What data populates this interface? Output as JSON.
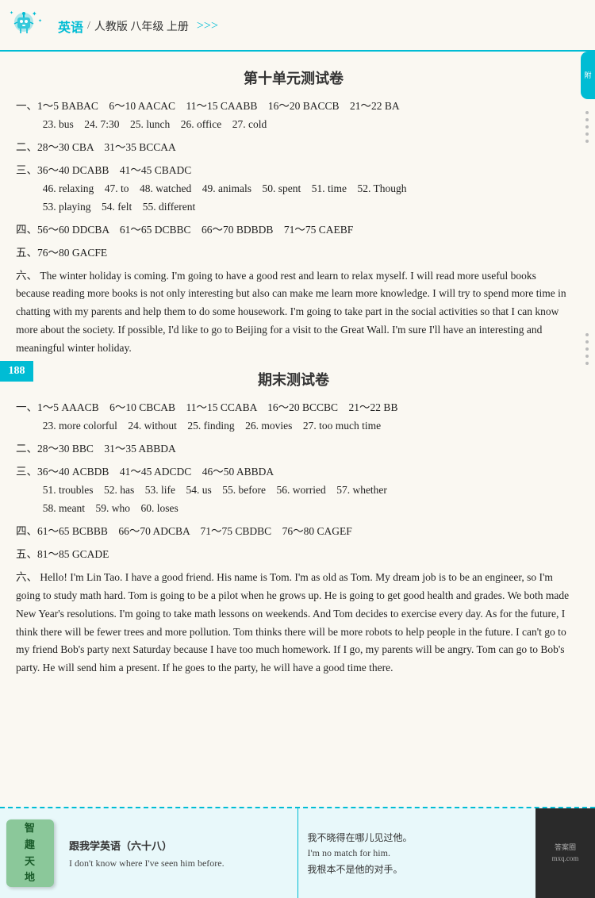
{
  "header": {
    "subject": "英语",
    "divider": "/",
    "grade_info": "人教版 八年级 上册",
    "arrows": ">>>",
    "logo_alt": "mascot-robot-logo"
  },
  "sections": [
    {
      "id": "section1",
      "title": "第十单元测试卷",
      "answers": [
        {
          "label": "一、",
          "lines": [
            "1～5 BABAC　6～10 AACAC　11～15 CAABB　16～20 BACCB　21～22 BA",
            "23. bus　24. 7:30　25. lunch　26. office　27. cold"
          ]
        },
        {
          "label": "二、",
          "lines": [
            "28～30 CBA　31～35 BCCAA"
          ]
        },
        {
          "label": "三、",
          "lines": [
            "36～40 DCABB　41～45 CBADC",
            "46. relaxing　47. to　48. watched　49. animals　50. spent　51. time　52. Though",
            "53. playing　54. felt　55. different"
          ]
        },
        {
          "label": "四、",
          "lines": [
            "56～60 DDCBA　61～65 DCBBC　66～70 BDBDB　71～75 CAEBF"
          ]
        },
        {
          "label": "五、",
          "lines": [
            "76～80 GACFE"
          ]
        },
        {
          "label": "六、",
          "is_essay": true,
          "text": "The winter holiday is coming. I'm going to have a good rest and learn to relax myself. I will read more useful books because reading more books is not only interesting but also can make me learn more knowledge. I will try to spend more time in chatting with my parents and help them to do some housework. I'm going to take part in the social activities so that I can know more about the society. If possible, I'd like to go to Beijing for a visit to the Great Wall. I'm sure I'll have an interesting and meaningful winter holiday."
        }
      ]
    },
    {
      "id": "section2",
      "title": "期末测试卷",
      "answers": [
        {
          "label": "一、",
          "lines": [
            "1～5 AAACB　6～10 CBCAB　11～15 CCABA　16～20 BCCBC　21～22 BB",
            "23. more colorful　24. without　25. finding　26. movies　27. too much time"
          ]
        },
        {
          "label": "二、",
          "lines": [
            "28～30 BBC　31～35 ABBDA"
          ]
        },
        {
          "label": "三、",
          "lines": [
            "36～40 ACBDB　41～45 ADCDC　46～50 ABBDA",
            "51. troubles　52. has　53. life　54. us　55. before　56. worried　57. whether",
            "58. meant　59. who　60. loses"
          ]
        },
        {
          "label": "四、",
          "lines": [
            "61～65 BCBBB　66～70 ADCBA　71～75 CBDBC　76～80 CAGEF"
          ]
        },
        {
          "label": "五、",
          "lines": [
            "81～85 GCADE"
          ]
        },
        {
          "label": "六、",
          "is_essay": true,
          "text": "Hello! I'm Lin Tao. I have a good friend. His name is Tom. I'm as old as Tom. My dream job is to be an engineer, so I'm going to study math hard. Tom is going to be a pilot when he grows up. He is going to get good health and grades. We both made New Year's resolutions. I'm going to take math lessons on weekends. And Tom decides to exercise every day. As for the future, I think there will be fewer trees and more pollution. Tom thinks there will be more robots to help people in the future. I can't go to my friend Bob's party next Saturday because I have too much homework. If I go, my parents will be angry. Tom can go to Bob's party. He will send him a present. If he goes to the party, he will have a good time there."
        }
      ]
    }
  ],
  "page_number": "188",
  "bottom": {
    "scroll_label": "智\n趣\n天\n地",
    "section_label": "跟我学英语（六十八）",
    "english_line": "I don't know where I've seen him before.",
    "chinese_line1": "我不晓得在哪儿见过他。",
    "english_translation": "I'm no match for him.",
    "chinese_line2": "我根本不是他的对手。"
  },
  "watermark": "答案圈\nmxq.com"
}
